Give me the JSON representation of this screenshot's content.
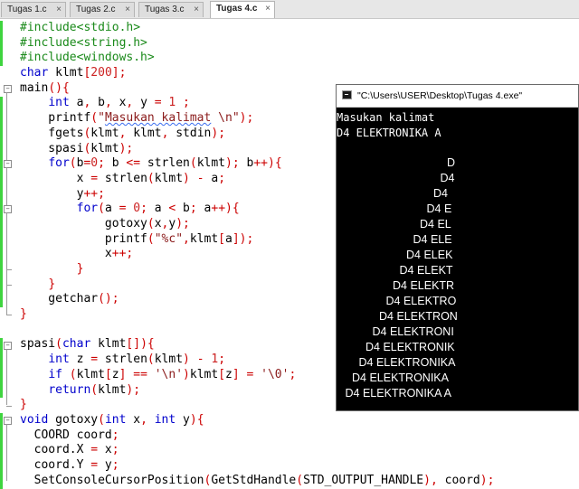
{
  "tabs": [
    {
      "label": "Tugas 1.c",
      "active": false
    },
    {
      "label": "Tugas 2.c",
      "active": false
    },
    {
      "label": "Tugas 3.c",
      "active": false
    },
    {
      "label": "Tugas 4.c",
      "active": true
    }
  ],
  "close_glyph": "×",
  "code_lines": [
    "#include<stdio.h>",
    "#include<string.h>",
    "#include<windows.h>",
    "char klmt[200];",
    "main(){",
    "    int a, b, x, y = 1 ;",
    "    printf(\"Masukan kalimat \\n\");",
    "    fgets(klmt, klmt, stdin);",
    "    spasi(klmt);",
    "    for(b=0; b <= strlen(klmt); b++){",
    "        x = strlen(klmt) - a;",
    "        y++;",
    "        for(a = 0; a < b; a++){",
    "            gotoxy(x,y);",
    "            printf(\"%c\",klmt[a]);",
    "            x++;",
    "        }",
    "    }",
    "    getchar();",
    "}",
    "",
    "spasi(char klmt[]){",
    "    int z = strlen(klmt) - 1;",
    "    if (klmt[z] == '\\n')klmt[z] = '\\0';",
    "    return(klmt);",
    "}",
    "void gotoxy(int x, int y){",
    "  COORD coord;",
    "  coord.X = x;",
    "  coord.Y = y;",
    "  SetConsoleCursorPosition(GetStdHandle(STD_OUTPUT_HANDLE), coord);"
  ],
  "console": {
    "title": "\"C:\\Users\\USER\\Desktop\\Tugas 4.exe\"",
    "prompt_lines": [
      "Masukan kalimat",
      "D4 ELEKTRONIKA A"
    ],
    "pyramid_lines": [
      "D",
      "D4",
      "D4",
      "D4 E",
      "D4 EL",
      "D4 ELE",
      "D4 ELEK",
      "D4 ELEKT",
      "D4 ELEKTR",
      "D4 ELEKTRO",
      "D4 ELEKTRON",
      "D4 ELEKTRONI",
      "D4 ELEKTRONIK",
      "D4 ELEKTRONIKA",
      "D4 ELEKTRONIKA",
      "D4 ELEKTRONIKA A"
    ]
  },
  "colors": {
    "change_bar": "#3fd43f",
    "keyword": "#0000cc",
    "preprocessor": "#1a8a1a",
    "string": "#8a1a1a",
    "console_bg": "#000000",
    "console_fg": "#ffffff"
  },
  "icons": {
    "tab_close": "close-icon",
    "console_app": "console-app-icon",
    "fold": "fold-collapse-icon"
  }
}
